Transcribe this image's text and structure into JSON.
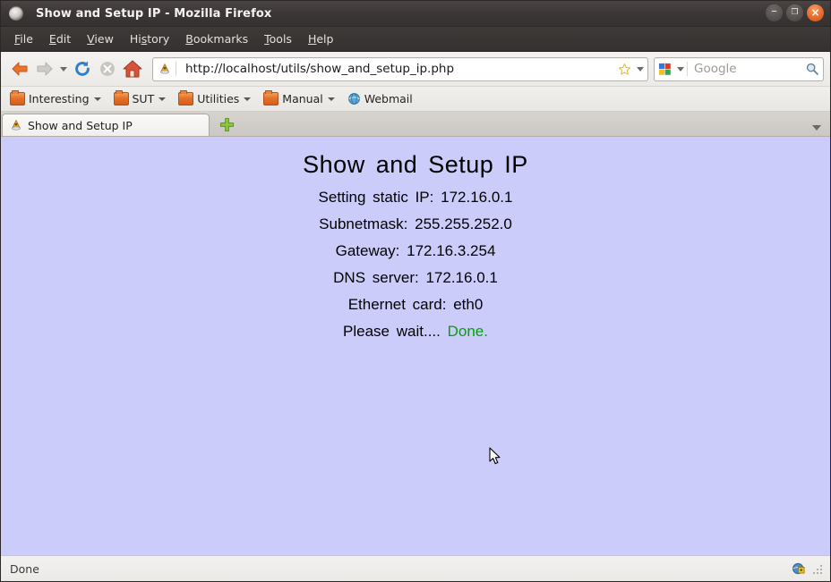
{
  "window": {
    "title": "Show and Setup IP - Mozilla Firefox",
    "app_icon": "firefox-window-icon",
    "controls": {
      "minimize": "–",
      "maximize": "❐",
      "close": "×"
    }
  },
  "menubar": {
    "items": [
      {
        "label": "File",
        "accesskey": "F"
      },
      {
        "label": "Edit",
        "accesskey": "E"
      },
      {
        "label": "View",
        "accesskey": "V"
      },
      {
        "label": "History",
        "accesskey": "s"
      },
      {
        "label": "Bookmarks",
        "accesskey": "B"
      },
      {
        "label": "Tools",
        "accesskey": "T"
      },
      {
        "label": "Help",
        "accesskey": "H"
      }
    ]
  },
  "toolbar": {
    "back_icon": "back-arrow-icon",
    "forward_icon": "forward-arrow-icon",
    "history_dropdown_icon": "chevron-down-icon",
    "reload_icon": "reload-icon",
    "stop_icon": "stop-icon",
    "home_icon": "home-icon",
    "url": "http://localhost/utils/show_and_setup_ip.php",
    "url_favicon": "site-favicon",
    "bookmark_star_icon": "star-icon",
    "url_dropdown_icon": "chevron-down-icon",
    "search": {
      "engine": "Google",
      "engine_icon": "google-icon",
      "placeholder": "Google",
      "value": "",
      "go_icon": "search-icon"
    }
  },
  "bookmarks": {
    "items": [
      {
        "label": "Interesting",
        "icon": "folder-icon",
        "has_menu": true
      },
      {
        "label": "SUT",
        "icon": "folder-icon",
        "has_menu": true
      },
      {
        "label": "Utilities",
        "icon": "folder-icon",
        "has_menu": true
      },
      {
        "label": "Manual",
        "icon": "folder-icon",
        "has_menu": true
      },
      {
        "label": "Webmail",
        "icon": "globe-icon",
        "has_menu": false
      }
    ]
  },
  "tabs": {
    "items": [
      {
        "label": "Show and Setup IP",
        "icon": "site-favicon",
        "active": true
      }
    ],
    "new_tab_icon": "plus-icon",
    "tab_list_icon": "chevron-down-icon"
  },
  "page": {
    "background_color": "#ccccfa",
    "title": "Show and Setup IP",
    "lines": [
      {
        "label": "Setting static IP:",
        "value": "172.16.0.1"
      },
      {
        "label": "Subnetmask:",
        "value": "255.255.252.0"
      },
      {
        "label": "Gateway:",
        "value": "172.16.3.254"
      },
      {
        "label": "DNS server:",
        "value": "172.16.0.1"
      },
      {
        "label": "Ethernet card:",
        "value": "eth0"
      }
    ],
    "wait_text": "Please wait....",
    "done_text": "Done.",
    "done_color": "#00a400",
    "cursor_icon": "mouse-pointer-icon"
  },
  "statusbar": {
    "text": "Done",
    "security_icon": "globe-lock-icon",
    "resize_grip_icon": "resize-grip-icon"
  }
}
